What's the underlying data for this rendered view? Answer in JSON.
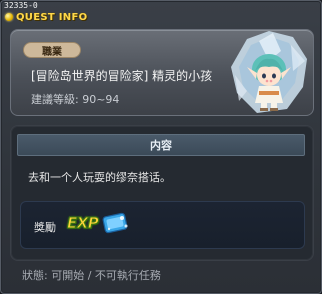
{
  "quest_id": "32335-0",
  "window": {
    "title": "QUEST INFO"
  },
  "quest": {
    "category_badge": "職業",
    "name": "[冒险岛世界的冒险家] 精灵的小孩",
    "level_requirement": "建議等級: 90~94"
  },
  "content": {
    "header": "内容",
    "text": "去和一个人玩耍的缪奈搭话。"
  },
  "reward": {
    "label": "獎勵",
    "items": [
      {
        "name": "exp-icon",
        "text": "EXP"
      },
      {
        "name": "exp-card-icon"
      }
    ]
  },
  "status": {
    "text": "狀態: 可開始 / 不可執行任務"
  },
  "colors": {
    "title": "#ffd84a",
    "badge_bg": "#cdb89a",
    "header_bg": "#3b4a58"
  }
}
